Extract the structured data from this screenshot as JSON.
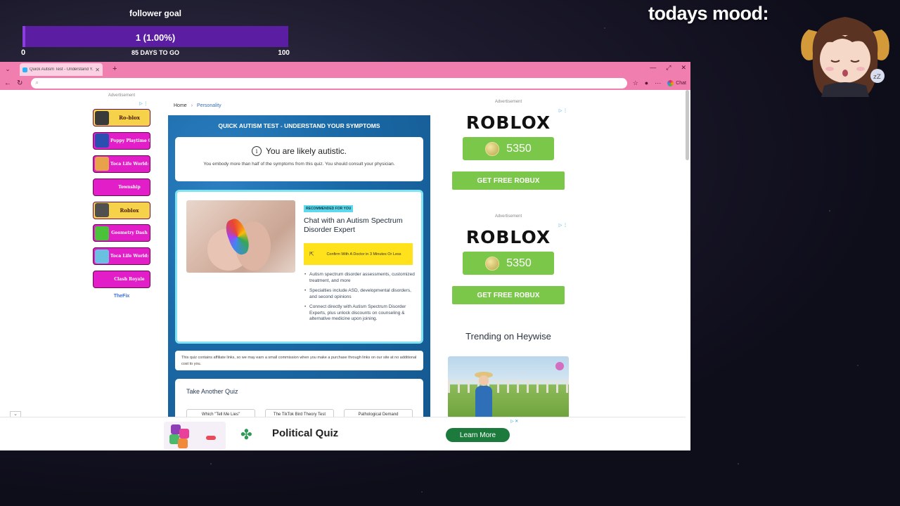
{
  "overlay": {
    "goal_title": "follower goal",
    "goal_value": "1 (1.00%)",
    "goal_progress_fraction": 0.01,
    "goal_min": "0",
    "goal_days": "85 DAYS TO GO",
    "goal_max": "100",
    "mood_label": "todays mood:"
  },
  "browser": {
    "tab_title": "Quick Autism Test - Understand Y...",
    "new_tab_icon": "plus-icon",
    "address_placeholder": "",
    "chat_label": "Chat"
  },
  "page": {
    "left_ad_label": "Advertisement",
    "games": [
      {
        "label": "Ro-blox",
        "style": "yellow",
        "thumb_color": "#3a3a3a"
      },
      {
        "label": "Poppy Playtime Ch...",
        "style": "magenta",
        "thumb_color": "#2a4fb0"
      },
      {
        "label": "Toca Life World: B...",
        "style": "magenta",
        "thumb_color": "#e8a24a"
      },
      {
        "label": "Township",
        "style": "magenta",
        "thumb_color": ""
      },
      {
        "label": "Roblox",
        "style": "yellow",
        "thumb_color": "#505050"
      },
      {
        "label": "Geometry Dash",
        "style": "magenta",
        "thumb_color": "#4ac23a"
      },
      {
        "label": "Toca Life World: B...",
        "style": "magenta",
        "thumb_color": "#6ac0e0"
      },
      {
        "label": "Clash Royale",
        "style": "magenta",
        "thumb_color": ""
      }
    ],
    "small_logo": "TheFix",
    "breadcrumb": {
      "home": "Home",
      "separator": "›",
      "current": "Personality"
    },
    "quiz_title": "QUICK AUTISM TEST - UNDERSTAND YOUR SYMPTOMS",
    "result_title": "You are likely autistic.",
    "result_text": "You embody more than half of the symptoms from this quiz. You should consult your physician.",
    "rec": {
      "badge": "RECOMMENDED FOR YOU",
      "title": "Chat with an Autism Spectrum Disorder Expert",
      "cta": "Confirm With A Doctor in 3 Minutes Or Less",
      "bullets": [
        "Autism spectrum disorder assessments, customized treatment, and more",
        "Specialties include ASD, developmental disorders, and second opinions",
        "Connect directly with Autism Spectrum Disorder Experts, plus unlock discounts on counseling & alternative medicine upon joining."
      ]
    },
    "affiliate_text": "This quiz contains affiliate links, so we may earn a small commission when you make a purchase through links on our site at no additional cost to you.",
    "another_title": "Take Another Quiz",
    "another_quizzes": [
      "Which \"Tell Me Lies\"",
      "The TikTok Bird Theory Test",
      "Pathological Demand"
    ],
    "right_ads": [
      {
        "label": "Advertisement",
        "brand": "ROBLOX",
        "amount": "5350",
        "button": "GET FREE ROBUX"
      },
      {
        "label": "Advertisement",
        "brand": "ROBLOX",
        "amount": "5350",
        "button": "GET FREE ROBUX"
      }
    ],
    "trending_title": "Trending on Heywise",
    "bottom_ad": {
      "title": "Political Quiz",
      "button": "Learn More"
    }
  },
  "colors": {
    "tab_bar": "#f07fb0",
    "quiz_blue": "#1a6aa8",
    "robux_green": "#7bc74a",
    "cta_yellow": "#ffe21c",
    "game_magenta": "#e21ec8",
    "game_yellow": "#f5d24a",
    "goal_purple": "#5b1ea3"
  }
}
